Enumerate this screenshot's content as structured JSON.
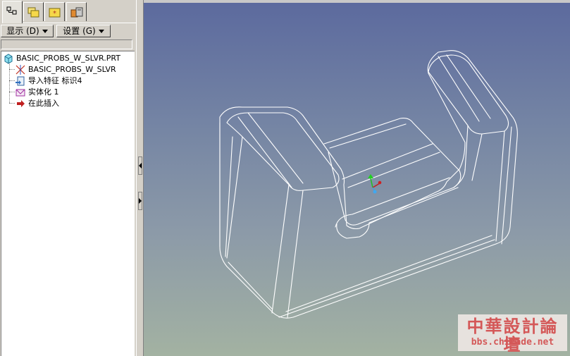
{
  "navigator": {
    "tabs": [
      {
        "name": "model-tree",
        "icon": "model-tree-icon",
        "active": true
      },
      {
        "name": "folder-browser",
        "icon": "folder-browser-icon",
        "active": false
      },
      {
        "name": "favorites",
        "icon": "favorites-folder-icon",
        "active": false
      },
      {
        "name": "connections",
        "icon": "connections-icon",
        "active": false
      }
    ],
    "show_menu_label": "显示 (D)",
    "settings_menu_label": "设置 (G)",
    "filter_value": "",
    "tree": {
      "root_label": "BASIC_PROBS_W_SLVR.PRT",
      "items": [
        {
          "label": "BASIC_PROBS_W_SLVR",
          "icon": "coordinate-system-icon"
        },
        {
          "label": "导入特征 标识4",
          "icon": "import-feature-icon"
        },
        {
          "label": "实体化 1",
          "icon": "solidify-icon"
        },
        {
          "label": "在此插入",
          "icon": "insert-here-arrow-icon"
        }
      ]
    }
  },
  "graphics": {
    "model": "wireframe-solid-part",
    "watermark": {
      "title": "中華設計論壇",
      "url": "bbs.chinade.net"
    }
  },
  "colors": {
    "background_top": "#5c6a9e",
    "background_bottom": "#a3b2a2",
    "wireframe": "#ffffff",
    "watermark": "#d45858"
  }
}
